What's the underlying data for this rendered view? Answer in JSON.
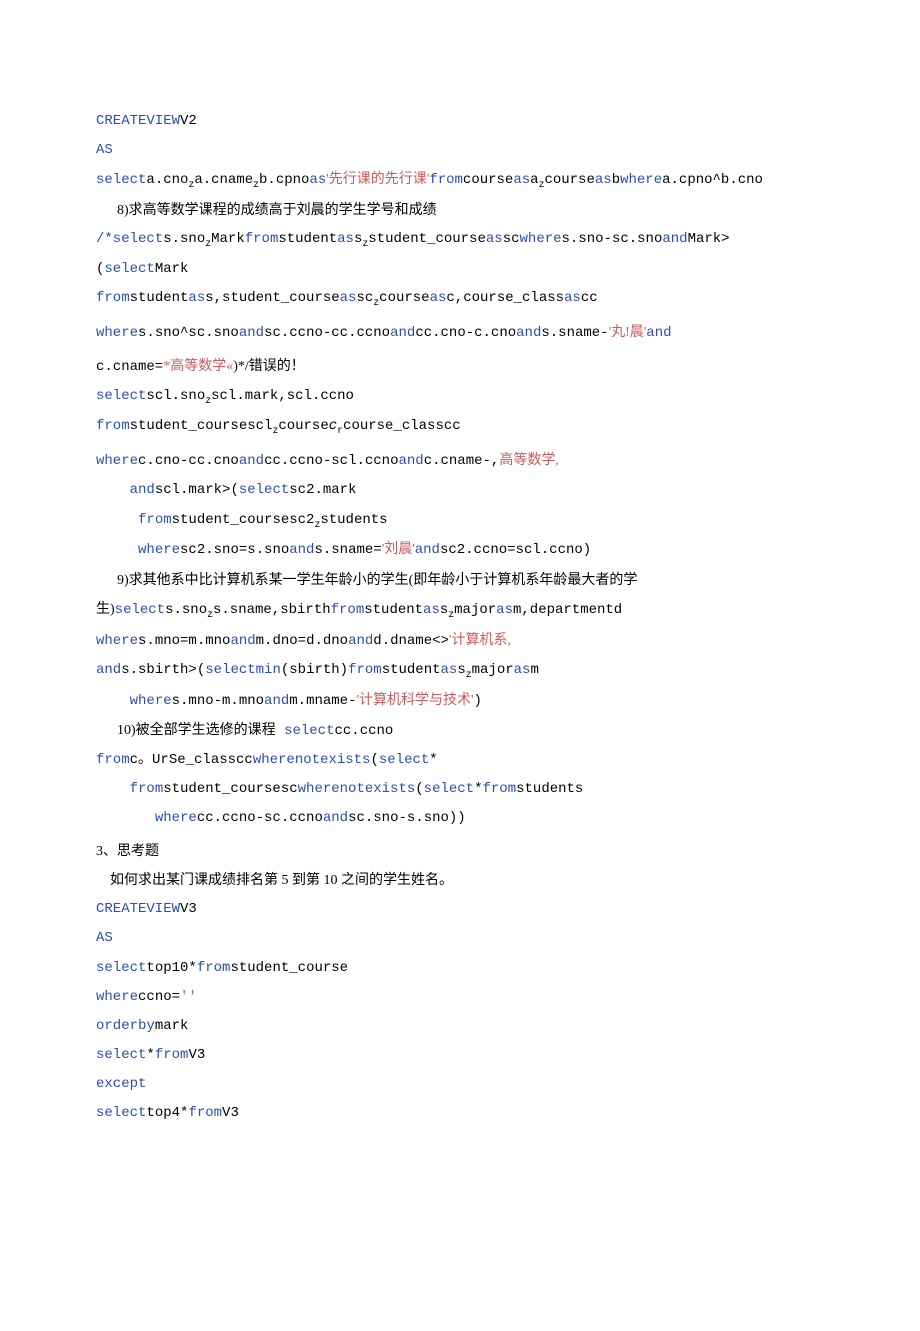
{
  "l01_kw": "CREATEVIEW",
  "l01_t": "V2",
  "l02_kw": "AS",
  "l03_kw1": "select",
  "l03_t1": "a.cno",
  "l03_z1": "z",
  "l03_t2": "a.cname",
  "l03_z2": "z",
  "l03_t3": "b.cpno",
  "l03_kw2": "as",
  "l03_s1": "'先行课的先行课'",
  "l03_kw3": "from",
  "l03_t4": "course",
  "l03_kw4": "as",
  "l03_t5": "a",
  "l03_z3": "z",
  "l03_t6": "course",
  "l03_kw5": "as",
  "l03_t7": "b",
  "l03_kw6": "where",
  "l03_t8": "a.cpno^b.cno",
  "l04": "      8)求高等数学课程的成绩高于刘晨的学生学号和成绩",
  "l05_kw1": "/*select",
  "l05_t1": "s.sno",
  "l05_z": "z",
  "l05_t2": "Mark",
  "l05_kw2": "from",
  "l05_t3": "student",
  "l05_kw3": "as",
  "l05_t4": "s",
  "l05_z2": "z",
  "l05_t5": "student_course",
  "l05_kw4": "as",
  "l05_t6": "sc",
  "l05_kw5": "where",
  "l05_t7": "s.sno-sc.sno",
  "l05_kw6": "and",
  "l05_t8": "Mark>",
  "l06_t1": "(",
  "l06_kw1": "select",
  "l06_t2": "Mark",
  "l07_kw1": "from",
  "l07_t1": "student",
  "l07_kw2": "as",
  "l07_t2": "s,student_course",
  "l07_kw3": "as",
  "l07_t3": "sc",
  "l07_z": "z",
  "l07_t4": "course",
  "l07_kw4": "as",
  "l07_t5": "c,course_class",
  "l07_kw5": "as",
  "l07_t6": "cc",
  "l08_kw1": "where",
  "l08_t1": "s.sno^sc.sno",
  "l08_kw2": "and",
  "l08_t2": "sc.ccno-cc.ccno",
  "l08_kw3": "and",
  "l08_t3": "cc.cno-c.cno",
  "l08_kw4": "and",
  "l08_t4": "s.sname-",
  "l08_s1": "'丸!晨'",
  "l08_kw5": "and",
  "l09_t1": "c.cname=",
  "l09_s1": "*高等数学«",
  "l09_t2": ")*/错误的！",
  "l10_kw1": "select",
  "l10_t1": "scl.sno",
  "l10_z": "z",
  "l10_t2": "scl.mark,scl.ccno",
  "l11_kw1": "from",
  "l11_t1": "student_coursescl",
  "l11_z1": "z",
  "l11_t2": "course",
  "l11_z2": "c",
  "l11_z3": "r",
  "l11_t3": "course_classcc",
  "l12_kw1": "where",
  "l12_t1": "c.cno-cc.cno",
  "l12_kw2": "and",
  "l12_t2": "cc.ccno-scl.ccno",
  "l12_kw3": "and",
  "l12_t3": "c.cname-,",
  "l12_s1": "高等数学,",
  "l13_kw1": "and",
  "l13_t1": "scl.mark>(",
  "l13_kw2": "select",
  "l13_t2": "sc2.mark",
  "l14_kw1": "from",
  "l14_t1": "student_coursesc2",
  "l14_z": "z",
  "l14_t2": "students",
  "l15_kw1": "where",
  "l15_t1": "sc2.sno=s.sno",
  "l15_kw2": "and",
  "l15_t2": "s.sname=",
  "l15_s1": "'刘晨'",
  "l15_kw3": "and",
  "l15_t3": "sc2.ccno=scl.ccno)",
  "l16": "      9)求其他系中比计算机系某一学生年龄小的学生(即年龄小于计算机系年龄最大者的学",
  "l17_t1": "生)",
  "l17_kw1": "select",
  "l17_t2": "s.sno",
  "l17_z": "z",
  "l17_t3": "s.sname,sbirth",
  "l17_kw2": "from",
  "l17_t4": "student",
  "l17_kw3": "as",
  "l17_t5": "s",
  "l17_z2": "z",
  "l17_t6": "major",
  "l17_kw4": "as",
  "l17_t7": "m,departmentd",
  "l18_kw1": "where",
  "l18_t1": "s.mno=m.mno",
  "l18_kw2": "and",
  "l18_t2": "m.dno=d.dno",
  "l18_kw3": "and",
  "l18_t3": "d.dname<>",
  "l18_s1": "'计算机系,",
  "l19_kw1": "and",
  "l19_t1": "s.sbirth>(",
  "l19_kw2": "selectmin",
  "l19_t2": "(sbirth)",
  "l19_kw3": "from",
  "l19_t3": "student",
  "l19_kw4": "as",
  "l19_t4": "s",
  "l19_z": "z",
  "l19_t5": "major",
  "l19_kw5": "as",
  "l19_t6": "m",
  "l20_kw1": "where",
  "l20_t1": "s.mno-m.mno",
  "l20_kw2": "and",
  "l20_t2": "m.mname-",
  "l20_s1": "'计算机科学与技术'",
  "l20_t3": ")",
  "l21_t1": "      10)被全部学生选修的课程",
  "l21_kw1": "select",
  "l21_t2": "cc.ccno",
  "l22_kw1": "from",
  "l22_t1": "c。UrSe_classcc",
  "l22_kw2": "wherenotexists",
  "l22_t2": "(",
  "l22_kw3": "select",
  "l22_t3": "*",
  "l23_kw1": "from",
  "l23_t1": "student_coursesc",
  "l23_kw2": "wherenotexists",
  "l23_t2": "(",
  "l23_kw3": "select",
  "l23_t3": "*",
  "l23_kw4": "from",
  "l23_t4": "students",
  "l24_kw1": "where",
  "l24_t1": "cc.ccno-sc.ccno",
  "l24_kw2": "and",
  "l24_t2": "sc.sno-s.sno))",
  "l25": "3、思考题",
  "l26": "    如何求出某门课成绩排名第 5 到第 10 之间的学生姓名。",
  "l27_kw1": "CREATEVIEW",
  "l27_t": "V3",
  "l28_kw": "AS",
  "l29_kw1": "select",
  "l29_t1": "top10*",
  "l29_kw2": "from",
  "l29_t2": "student_course",
  "l30_kw1": "where",
  "l30_t1": "ccno=",
  "l30_s1": "''",
  "l31_kw1": "orderby",
  "l31_t1": "mark",
  "l32_kw1": "select",
  "l32_t1": "*",
  "l32_kw2": "from",
  "l32_t2": "V3",
  "l33_kw1": "except",
  "l34_kw1": "select",
  "l34_t1": "top4*",
  "l34_kw2": "from",
  "l34_t2": "V3"
}
